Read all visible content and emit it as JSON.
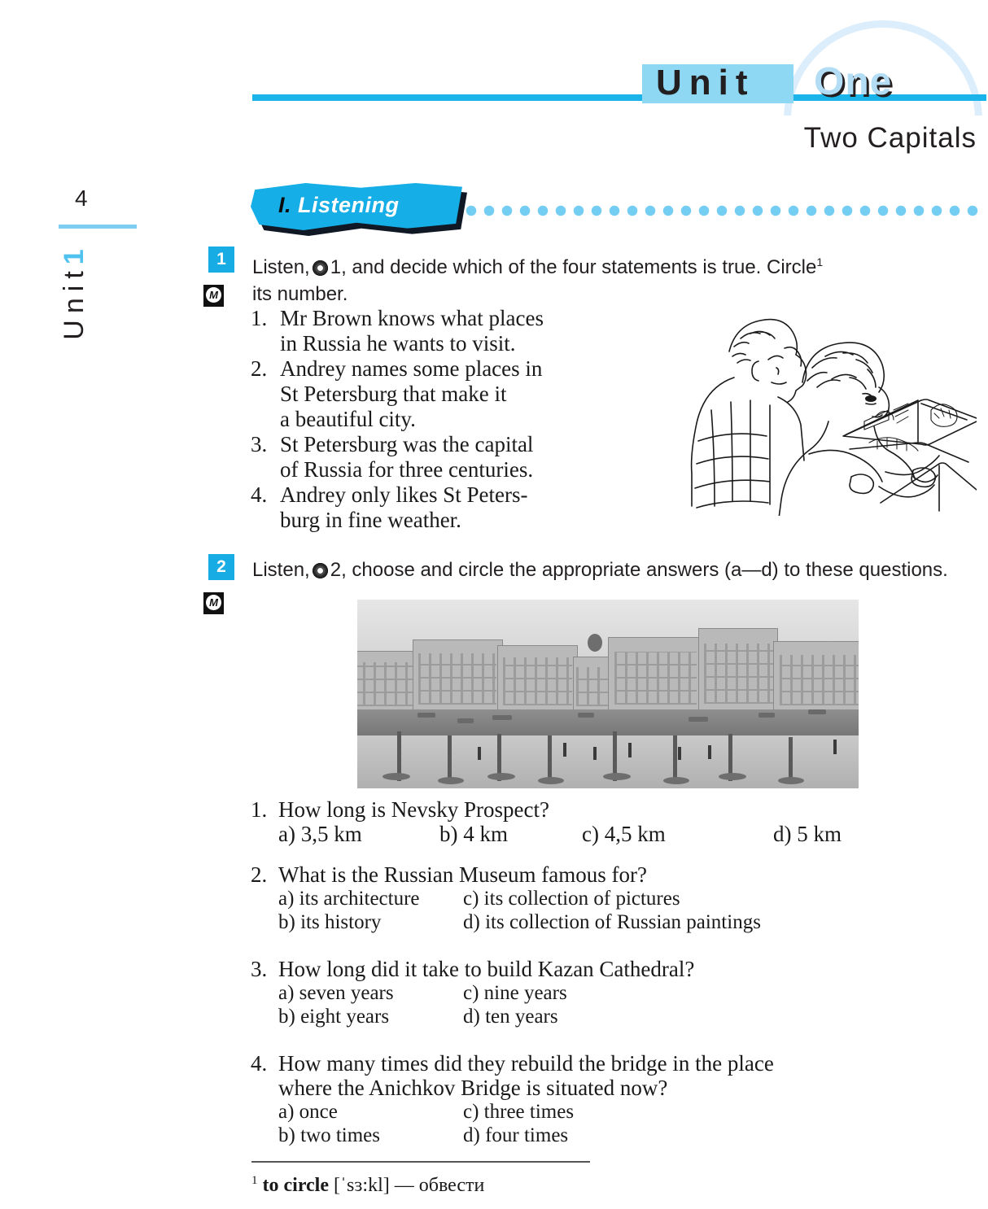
{
  "header": {
    "unit_word": "Unit",
    "unit_number_word": "One",
    "subtitle": "Two  Capitals"
  },
  "margin": {
    "page_number": "4",
    "vertical_label": "Unit",
    "vertical_number": "1"
  },
  "section": {
    "roman": "I.",
    "label": "Listening"
  },
  "exercise1": {
    "badge": "1",
    "media_badge": "M",
    "instruction_part1": "Listen,",
    "instruction_part2": "1, and decide which of the four statements is true. Circle",
    "footnote_marker": "1",
    "instruction_part3": "its number.",
    "statements": [
      {
        "num": "1.",
        "lines": [
          "Mr Brown  knows  what  places",
          "in Russia he wants to visit."
        ]
      },
      {
        "num": "2.",
        "lines": [
          "Andrey  names  some  places  in",
          "St Petersburg  that  make  it",
          "a beautiful city."
        ]
      },
      {
        "num": "3.",
        "lines": [
          "St Petersburg  was  the  capital",
          "of Russia for three centuries."
        ]
      },
      {
        "num": "4.",
        "lines": [
          "Andrey  only  likes  St  Peters-",
          "burg in fine weather."
        ]
      }
    ]
  },
  "exercise2": {
    "badge": "2",
    "media_badge": "M",
    "instruction_part1": "Listen,",
    "instruction_part2": "2, choose and circle the appropriate answers (a—d) to these questions.",
    "photo_caption": "",
    "questions": [
      {
        "num": "1.",
        "lines": [
          "How  long  is  Nevsky  Prospect?"
        ],
        "layout": "row",
        "options": [
          "a) 3,5  km",
          "b) 4  km",
          "c) 4,5  km",
          "d) 5  km"
        ]
      },
      {
        "num": "2.",
        "lines": [
          "What  is  the  Russian  Museum  famous  for?"
        ],
        "layout": "two-col",
        "options_left": [
          "a) its architecture",
          "b) its history"
        ],
        "options_right": [
          "c) its collection of pictures",
          "d) its collection of Russian paintings"
        ]
      },
      {
        "num": "3.",
        "lines": [
          "How  long  did  it  take  to build  Kazan  Cathedral?"
        ],
        "layout": "two-col",
        "options_left": [
          "a) seven  years",
          "b) eight  years"
        ],
        "options_right": [
          "c) nine  years",
          "d) ten  years"
        ]
      },
      {
        "num": "4.",
        "lines": [
          "How  many  times  did  they  rebuild  the  bridge  in  the  place",
          "where  the  Anichkov  Bridge  is  situated  now?"
        ],
        "layout": "two-col",
        "options_left": [
          "a) once",
          "b) two  times"
        ],
        "options_right": [
          "c) three  times",
          "d) four  times"
        ]
      }
    ]
  },
  "footnote": {
    "marker": "1",
    "headword": "to  circle",
    "transcription": "[ˈsɜ:kl]",
    "dash": "—",
    "translation": "обвести"
  },
  "colors": {
    "accent_blue": "#17ace4",
    "light_blue": "#8ed8f4",
    "pale_blue": "#dceefc",
    "dot_blue": "#74cdf2",
    "banner_shadow": "#101826",
    "ink": "#231f20"
  }
}
